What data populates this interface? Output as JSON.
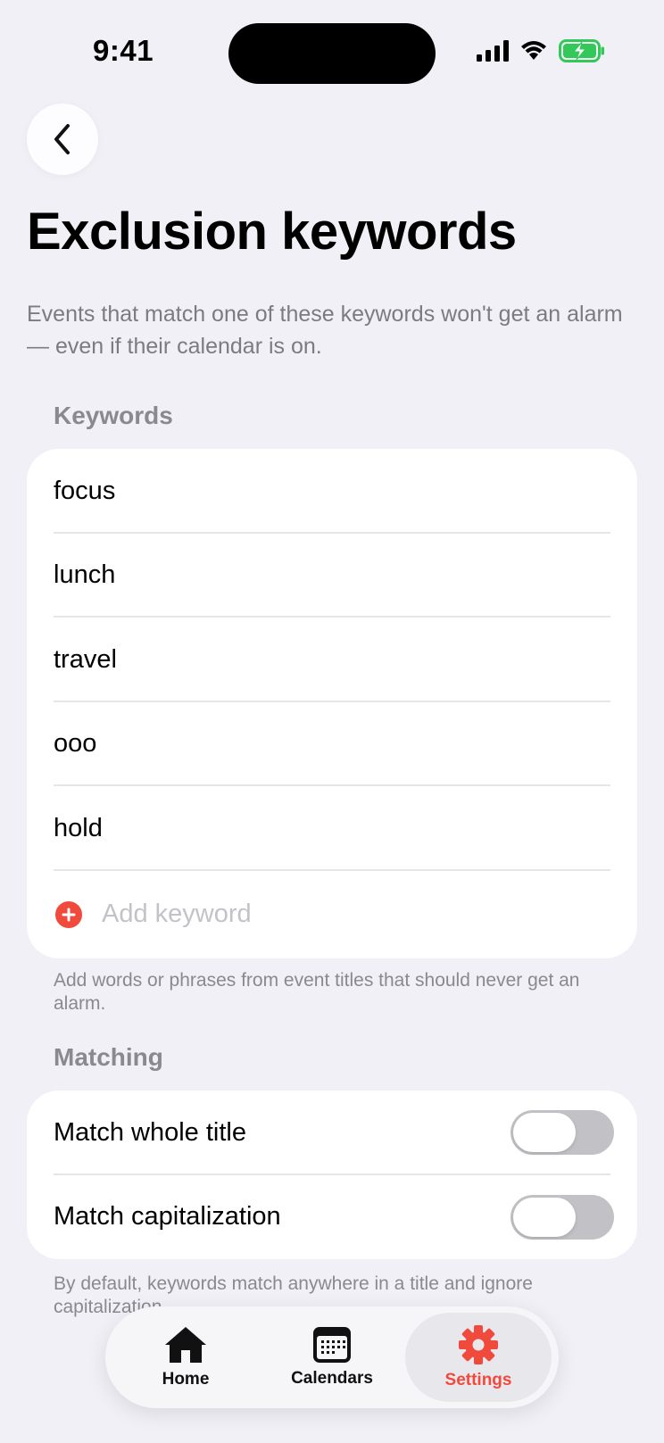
{
  "status": {
    "time": "9:41"
  },
  "page": {
    "title": "Exclusion keywords",
    "intro": "Events that match one of these keywords won't get an alarm — even if their calendar is on."
  },
  "keywords": {
    "header": "Keywords",
    "items": [
      "focus",
      "lunch",
      "travel",
      "ooo",
      "hold"
    ],
    "add_placeholder": "Add keyword",
    "footnote": "Add words or phrases from event titles that should never get an alarm."
  },
  "matching": {
    "header": "Matching",
    "options": [
      {
        "label": "Match whole title",
        "on": false
      },
      {
        "label": "Match capitalization",
        "on": false
      }
    ],
    "footnote": "By default, keywords match anywhere in a title and ignore capitalization."
  },
  "tabbar": {
    "tabs": [
      {
        "label": "Home",
        "icon": "house-icon"
      },
      {
        "label": "Calendars",
        "icon": "calendar-icon"
      },
      {
        "label": "Settings",
        "icon": "gear-icon"
      }
    ],
    "active": "Settings"
  },
  "colors": {
    "accent": "#f04a3c",
    "background": "#f1f0f6",
    "battery": "#34c759"
  }
}
